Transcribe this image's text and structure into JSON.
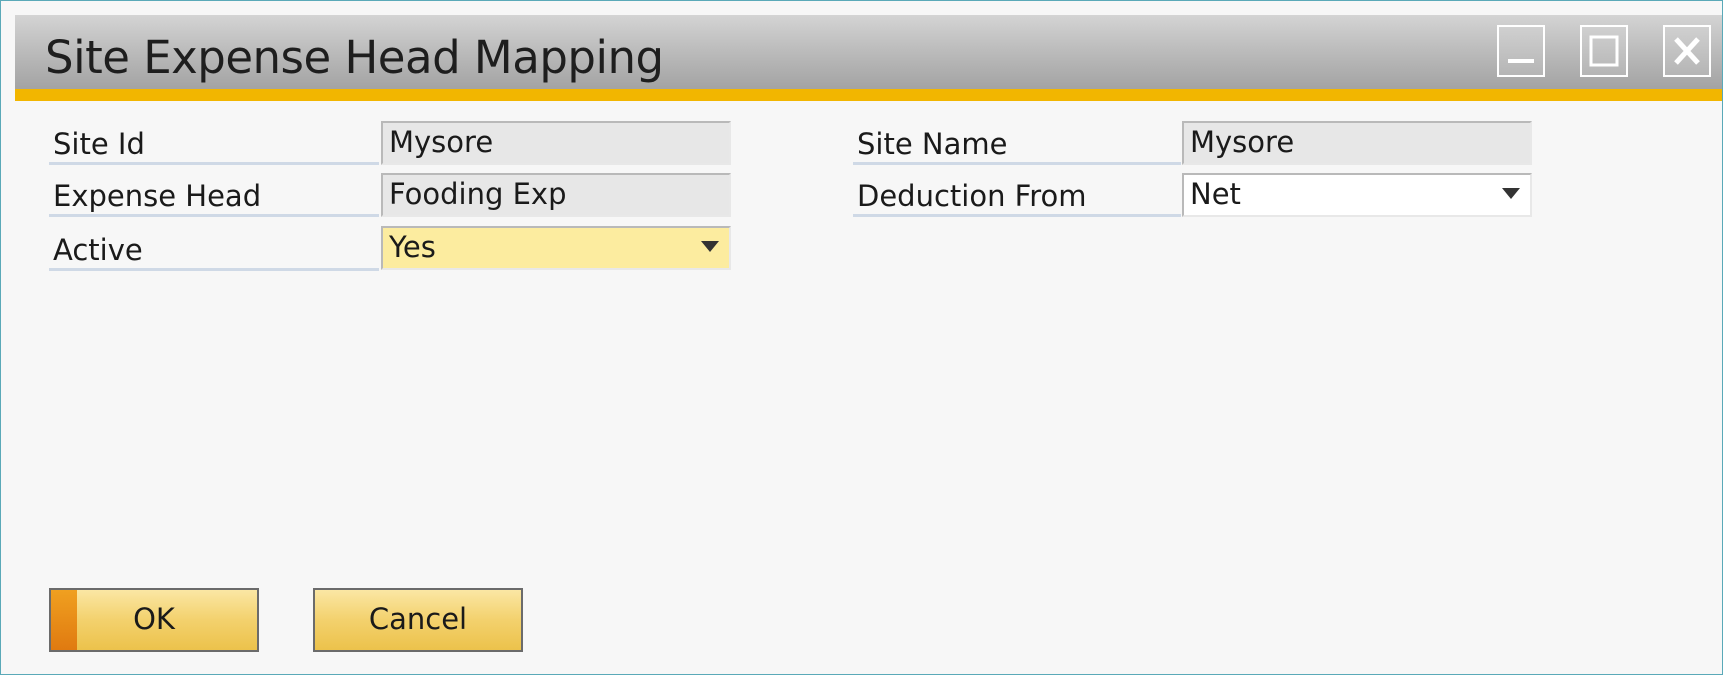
{
  "window": {
    "title": "Site Expense Head Mapping"
  },
  "form": {
    "site_id": {
      "label": "Site Id",
      "value": "Mysore"
    },
    "expense_head": {
      "label": "Expense Head",
      "value": "Fooding Exp"
    },
    "active": {
      "label": "Active",
      "value": "Yes"
    },
    "site_name": {
      "label": "Site Name",
      "value": "Mysore"
    },
    "deduction_from": {
      "label": "Deduction From",
      "value": "Net"
    }
  },
  "buttons": {
    "ok": "OK",
    "cancel": "Cancel"
  },
  "colors": {
    "accent_bar": "#f2b600",
    "active_field": "#fcec9f",
    "button": "#f3d16d"
  },
  "icons": [
    "minimize-icon",
    "maximize-icon",
    "close-icon",
    "dropdown-arrow-icon"
  ]
}
